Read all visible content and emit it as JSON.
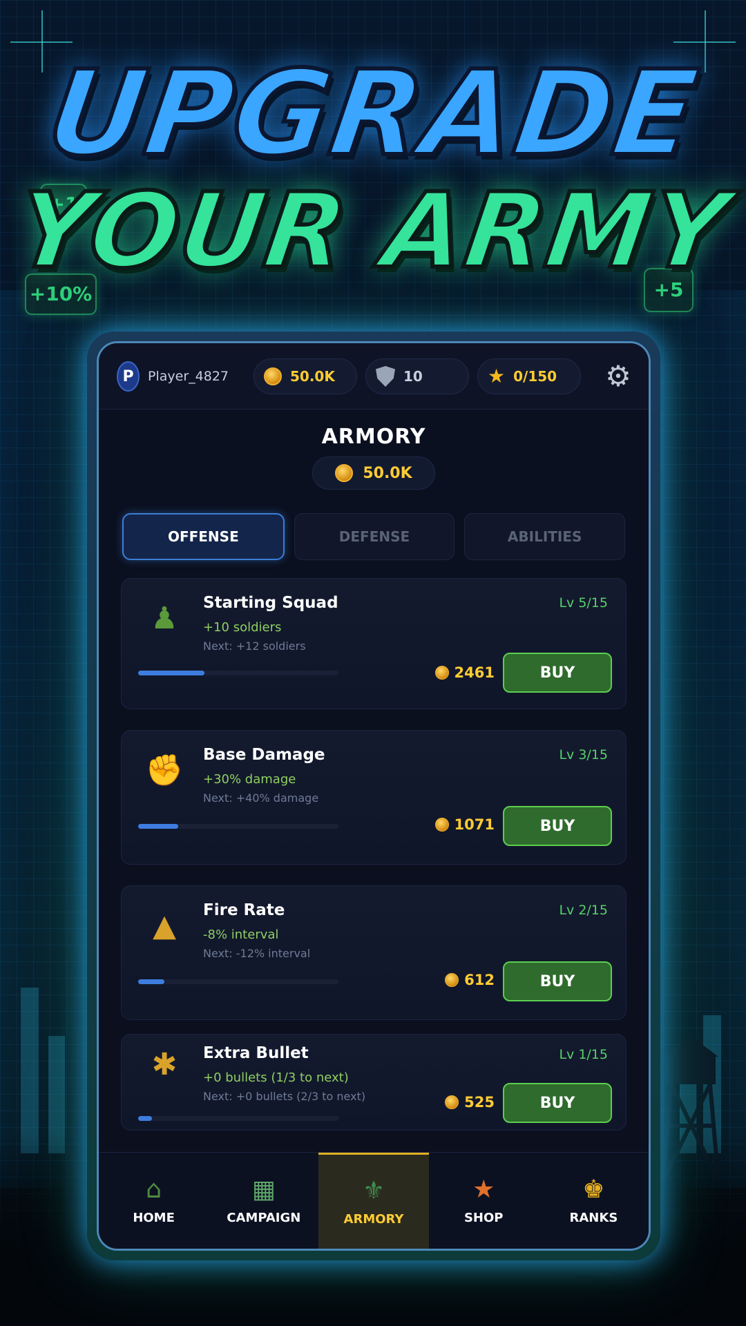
{
  "headline": {
    "line1": "UPGRADE",
    "line2": "YOUR ARMY"
  },
  "float_tags": [
    "+1",
    "+10%",
    "+5"
  ],
  "topbar": {
    "avatar_letter": "P",
    "player_name": "Player_4827",
    "coins": "50.0K",
    "shields": "10",
    "stars": "0/150"
  },
  "armory": {
    "title": "ARMORY",
    "balance": "50.0K"
  },
  "tabs": [
    {
      "label": "OFFENSE",
      "active": true
    },
    {
      "label": "DEFENSE",
      "active": false
    },
    {
      "label": "ABILITIES",
      "active": false
    }
  ],
  "upgrades": [
    {
      "icon": "squad-icon",
      "name": "Starting Squad",
      "effect": "+10 soldiers",
      "next": "Next: +12 soldiers",
      "level": "Lv 5/15",
      "progress": 0.33,
      "cost": "2461",
      "buy": "BUY"
    },
    {
      "icon": "fist-icon",
      "name": "Base Damage",
      "effect": "+30% damage",
      "next": "Next: +40% damage",
      "level": "Lv 3/15",
      "progress": 0.2,
      "cost": "1071",
      "buy": "BUY"
    },
    {
      "icon": "bullet-icon",
      "name": "Fire Rate",
      "effect": "-8% interval",
      "next": "Next: -12% interval",
      "level": "Lv 2/15",
      "progress": 0.13,
      "cost": "612",
      "buy": "BUY"
    },
    {
      "icon": "extra-bullet-icon",
      "name": "Extra Bullet",
      "effect": "+0 bullets (1/3 to next)",
      "next": "Next: +0 bullets (2/3 to next)",
      "level": "Lv 1/15",
      "progress": 0.07,
      "cost": "525",
      "buy": "BUY"
    }
  ],
  "nav": [
    {
      "icon": "home-icon",
      "label": "HOME",
      "active": false
    },
    {
      "icon": "map-icon",
      "label": "CAMPAIGN",
      "active": false
    },
    {
      "icon": "armory-icon",
      "label": "ARMORY",
      "active": true
    },
    {
      "icon": "shop-icon",
      "label": "SHOP",
      "active": false
    },
    {
      "icon": "trophy-icon",
      "label": "RANKS",
      "active": false
    }
  ],
  "colors": {
    "accent_blue": "#3b7fd8",
    "buy_green": "#2f6b2d",
    "gold": "#ffcc33",
    "level_green": "#56d26a"
  }
}
